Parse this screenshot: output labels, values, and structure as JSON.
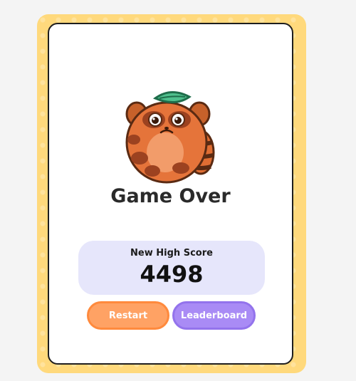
{
  "game_over": {
    "title": "Game Over",
    "score_label": "New High Score",
    "score_value": "4498",
    "buttons": {
      "restart": "Restart",
      "leaderboard": "Leaderboard"
    }
  },
  "colors": {
    "frame": "#ffd97c",
    "card": "#ffffff",
    "score_panel": "#e6e6fb",
    "restart": "#ffa264",
    "leaderboard": "#a98bf5"
  },
  "mascot": {
    "icon": "sad-raccoon-icon"
  }
}
